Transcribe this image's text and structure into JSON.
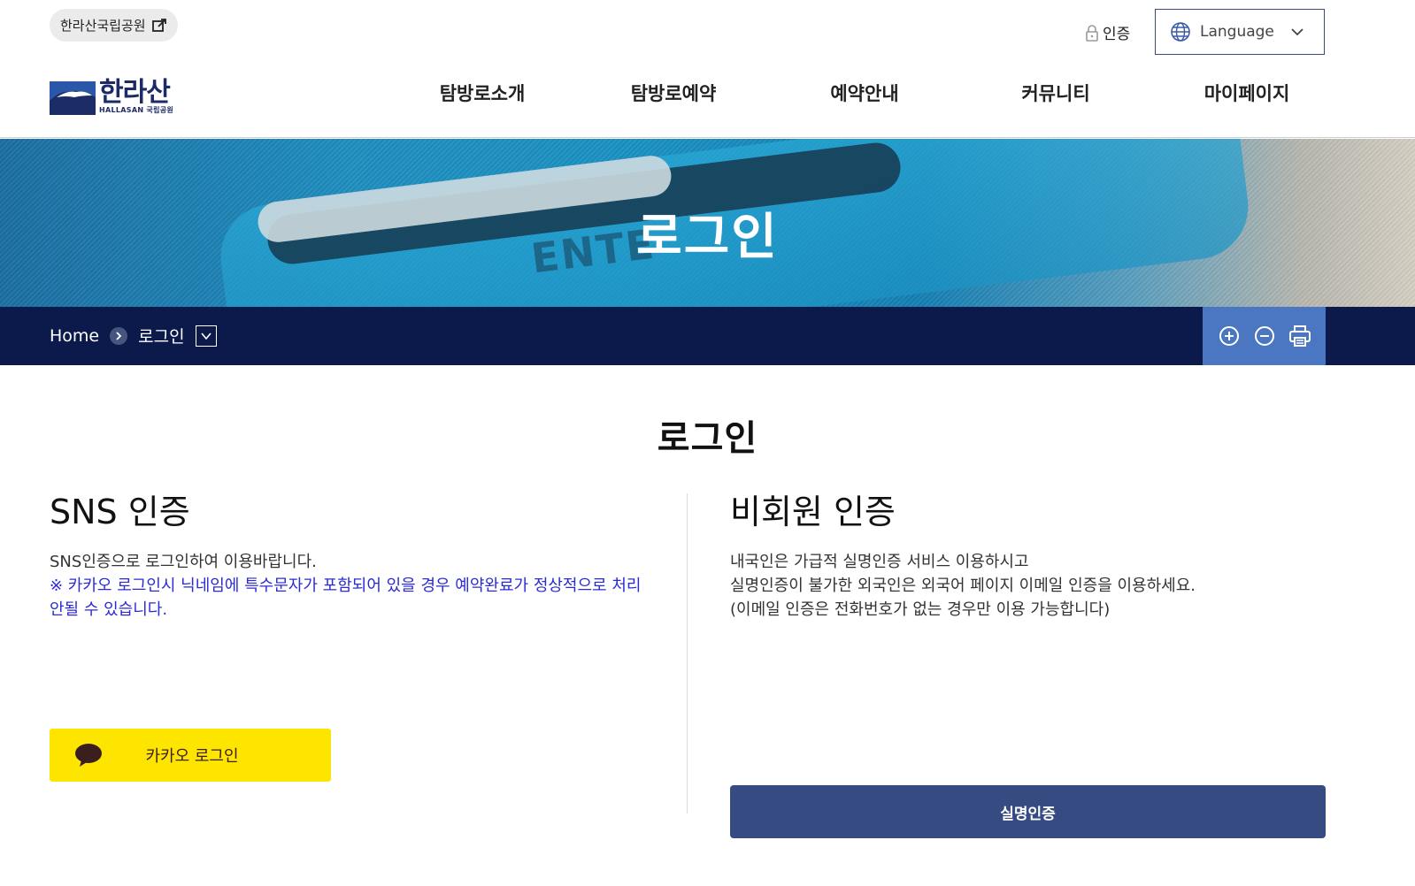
{
  "header": {
    "park_link": "한라산국립공원",
    "auth_label": "인증",
    "language_label": "Language",
    "logo_ko": "한라산",
    "logo_en": "HALLASAN 국립공원",
    "nav": [
      "탐방로소개",
      "탐방로예약",
      "예약안내",
      "커뮤니티",
      "마이페이지"
    ]
  },
  "banner": {
    "title": "로그인",
    "photo_text": "ENTE"
  },
  "location": {
    "home": "Home",
    "current": "로그인"
  },
  "content": {
    "page_title": "로그인",
    "sns": {
      "title": "SNS 인증",
      "desc": "SNS인증으로 로그인하여 이용바랍니다.",
      "notice_line1": "※ 카카오 로그인시 닉네임에 특수문자가 포함되어 있을 경우 예약완료가 정상적으로 처리",
      "notice_line2": "안될 수 있습니다.",
      "kakao_button": "카카오 로그인"
    },
    "guest": {
      "title": "비회원 인증",
      "line1": "내국인은 가급적 실명인증 서비스 이용하시고",
      "line2": "실명인증이 불가한 외국인은 외국어 페이지 이메일 인증을 이용하세요.",
      "line3": "(이메일 인증은 전화번호가 없는 경우만 이용 가능합니다)",
      "verify_button": "실명인증"
    }
  },
  "colors": {
    "navy": "#0b1a4a",
    "tools_blue": "#4b77c2",
    "kakao_yellow": "#fee500",
    "verify_button": "#354b82",
    "notice_blue": "#2b2bd6"
  },
  "icons": [
    "external-link-icon",
    "lock-icon",
    "globe-icon",
    "chevron-down-icon",
    "chevron-right-icon",
    "zoom-in-icon",
    "zoom-out-icon",
    "print-icon",
    "kakao-bubble-icon"
  ]
}
